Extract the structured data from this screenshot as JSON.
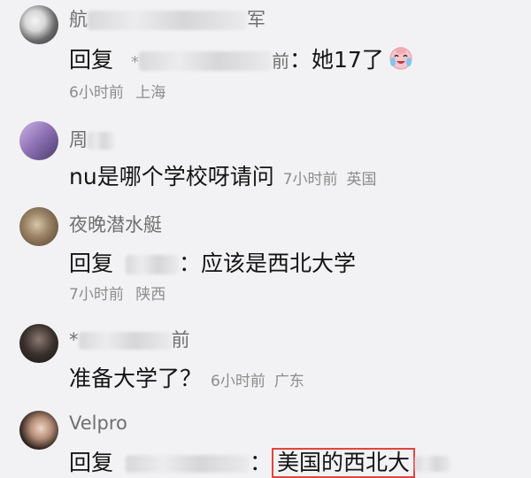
{
  "comments": [
    {
      "username": "航",
      "username_tail": "军",
      "reply_prefix": "回复",
      "reply_target_start": "*",
      "reply_target_tail": "前",
      "text": "她17了",
      "emoji": "crying-laughing-emoji",
      "time": "6小时前",
      "location": "上海"
    },
    {
      "username": "周",
      "text": "nu是哪个学校呀请问",
      "time": "7小时前",
      "location": "英国"
    },
    {
      "username": "夜晚潜水艇",
      "reply_prefix": "回复",
      "text": "应该是西北大学",
      "time": "7小时前",
      "location": "陕西"
    },
    {
      "username_start": "*",
      "username_tail": "前",
      "text": "准备大学了？",
      "time": "6小时前",
      "location": "广东"
    },
    {
      "username": "Velpro",
      "reply_prefix": "回复",
      "highlighted_text": "美国的西北大",
      "highlight_color": "#e0453c"
    }
  ],
  "colon": "："
}
